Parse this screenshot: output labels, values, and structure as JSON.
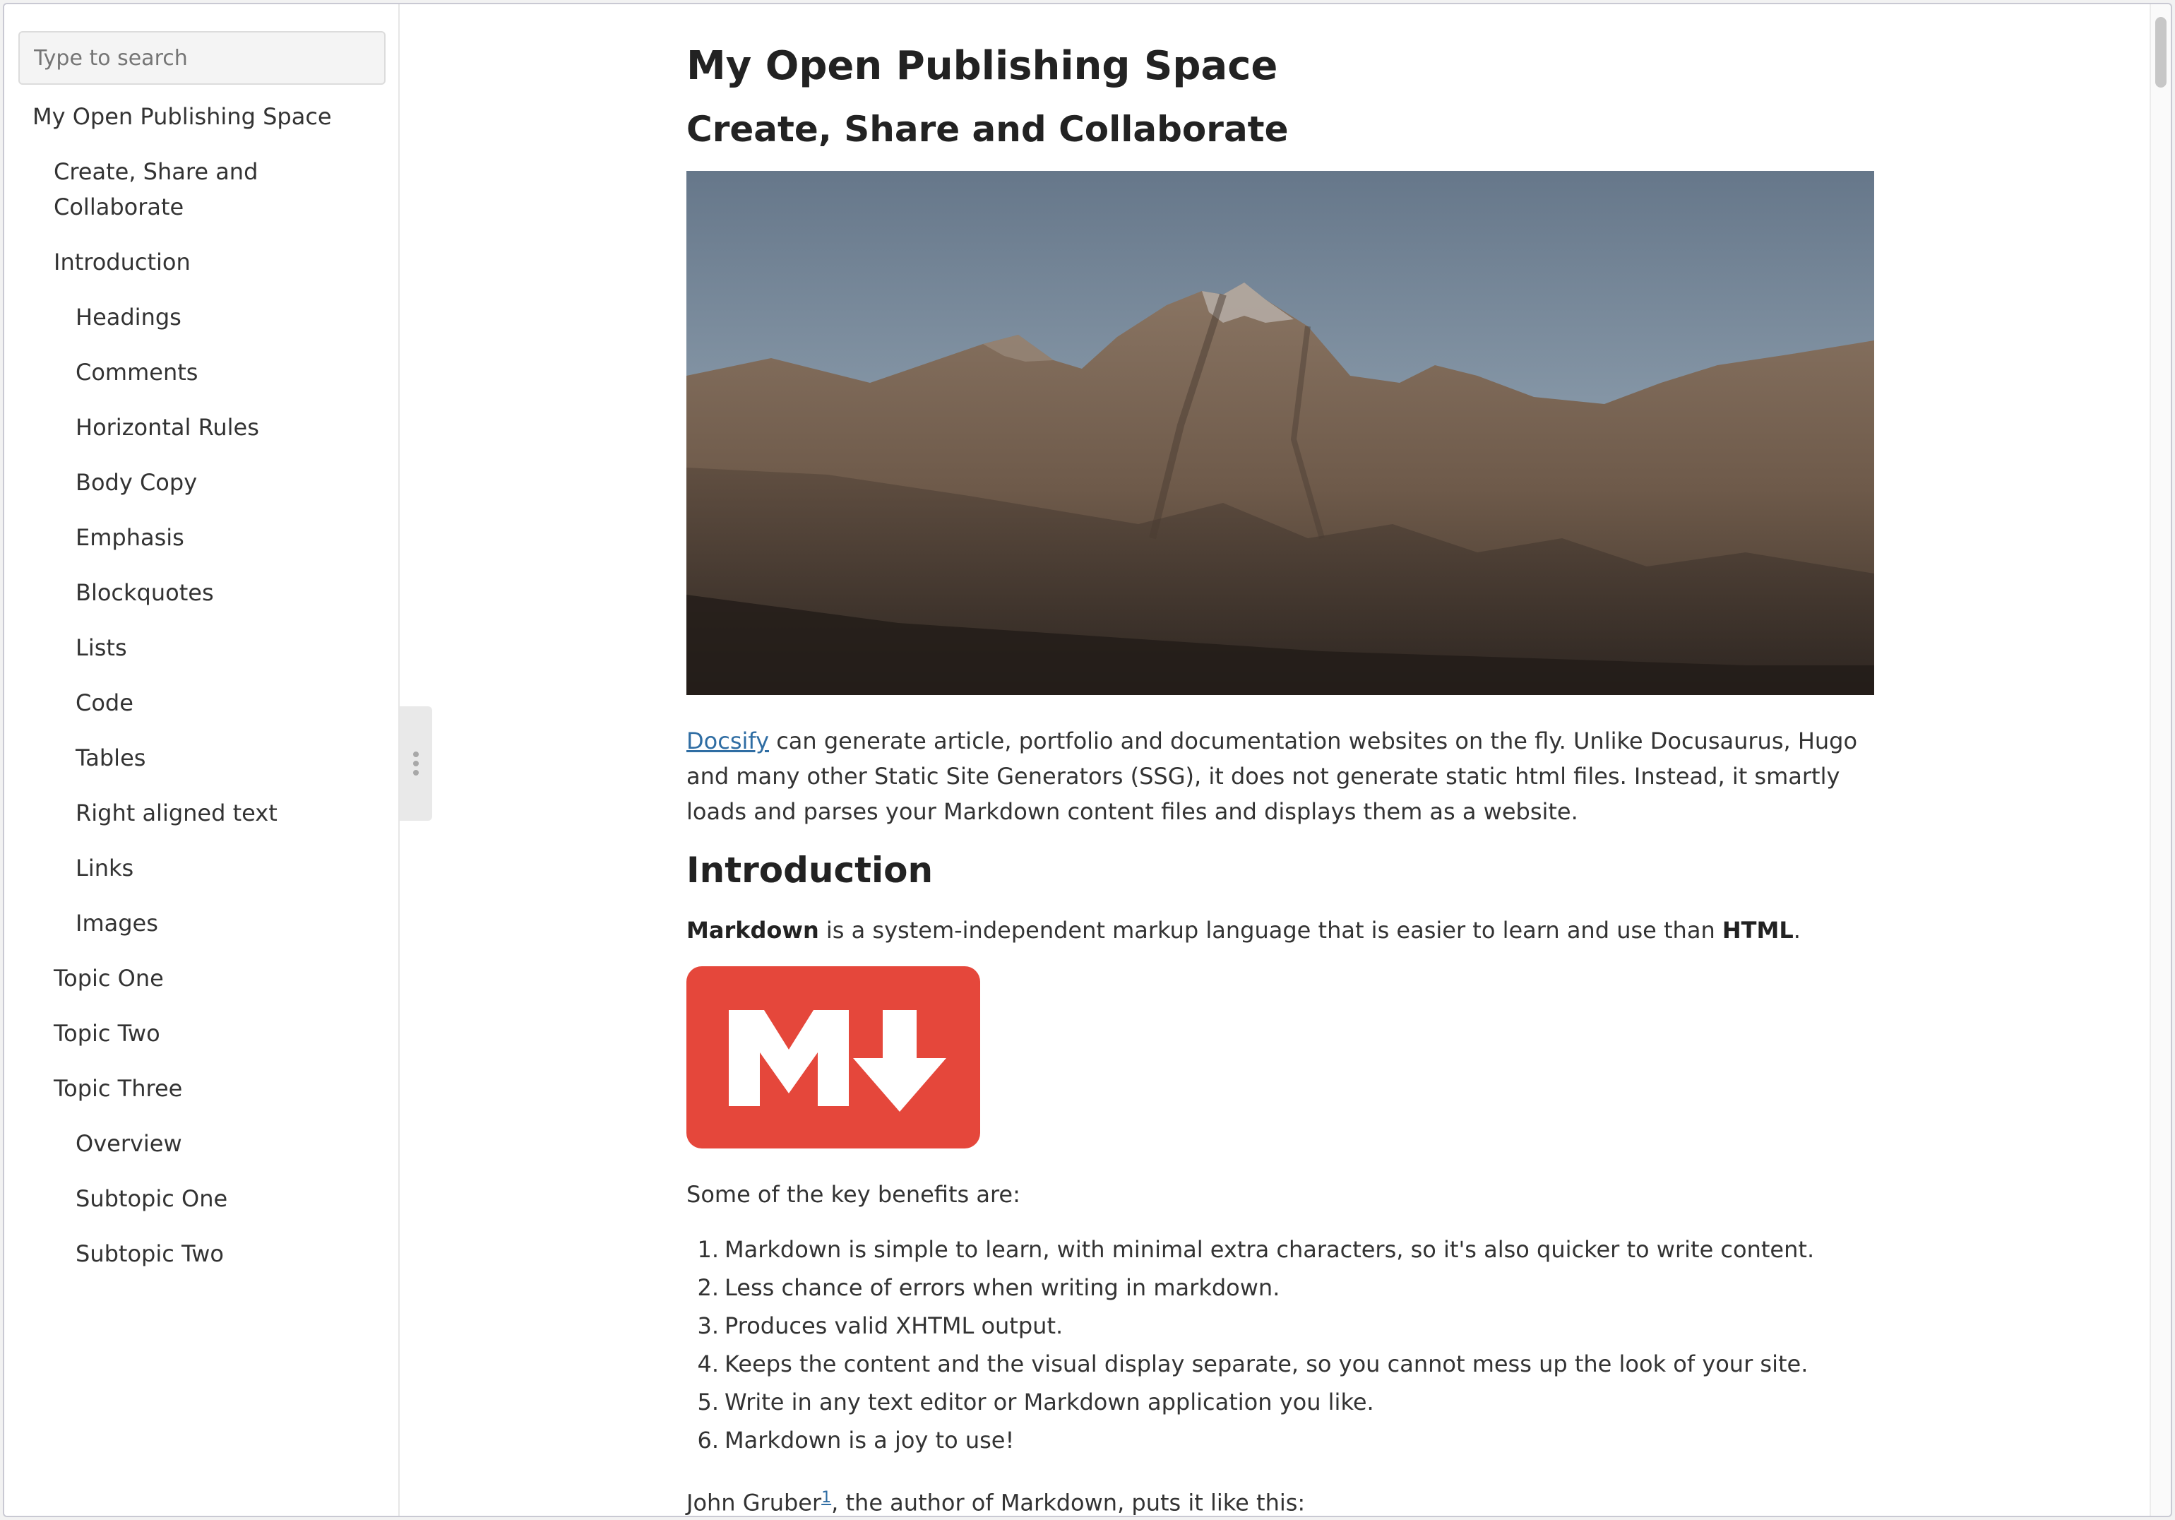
{
  "search": {
    "placeholder": "Type to search"
  },
  "sidebar": {
    "items": [
      {
        "label": "My Open Publishing Space",
        "level": 0
      },
      {
        "label": "Create, Share and Collaborate",
        "level": 1
      },
      {
        "label": "Introduction",
        "level": 1
      },
      {
        "label": "Headings",
        "level": 2
      },
      {
        "label": "Comments",
        "level": 2
      },
      {
        "label": "Horizontal Rules",
        "level": 2
      },
      {
        "label": "Body Copy",
        "level": 2
      },
      {
        "label": "Emphasis",
        "level": 2
      },
      {
        "label": "Blockquotes",
        "level": 2
      },
      {
        "label": "Lists",
        "level": 2
      },
      {
        "label": "Code",
        "level": 2
      },
      {
        "label": "Tables",
        "level": 2
      },
      {
        "label": "Right aligned text",
        "level": 2
      },
      {
        "label": "Links",
        "level": 2
      },
      {
        "label": "Images",
        "level": 2
      },
      {
        "label": "Topic One",
        "level": 1
      },
      {
        "label": "Topic Two",
        "level": 1
      },
      {
        "label": "Topic Three",
        "level": 1
      },
      {
        "label": "Overview",
        "level": 2
      },
      {
        "label": "Subtopic One",
        "level": 2
      },
      {
        "label": "Subtopic Two",
        "level": 2
      }
    ]
  },
  "main": {
    "title": "My Open Publishing Space",
    "subtitle": "Create, Share and Collaborate",
    "intro_link": "Docsify",
    "intro_text": " can generate article, portfolio and documentation websites on the fly. Unlike Docusaurus, Hugo and many other Static Site Generators (SSG), it does not generate static html files. Instead, it smartly loads and parses your Markdown content files and displays them as a website.",
    "section_heading": "Introduction",
    "md_bold": "Markdown",
    "md_text": " is a system-independent markup language that is easier to learn and use than ",
    "md_html": "HTML",
    "md_period": ".",
    "benefits_lead": "Some of the key benefits are:",
    "benefits": [
      {
        "num": "1.",
        "text": "Markdown is simple to learn, with minimal extra characters, so it's also quicker to write content."
      },
      {
        "num": "2.",
        "text": "Less chance of errors when writing in markdown."
      },
      {
        "num": "3.",
        "text": "Produces valid XHTML output."
      },
      {
        "num": "4.",
        "text": "Keeps the content and the visual display separate, so you cannot mess up the look of your site."
      },
      {
        "num": "5.",
        "text": "Write in any text editor or Markdown application you like."
      },
      {
        "num": "6.",
        "text": "Markdown is a joy to use!"
      }
    ],
    "gruber_name": "John Gruber",
    "gruber_footnote": "1",
    "gruber_rest": ", the author of Markdown, puts it like this:"
  },
  "colors": {
    "link": "#2f6da3",
    "markdown_logo": "#e5473b",
    "sky": "#7b8ea0"
  },
  "icons": {
    "markdown_logo": "markdown-logo-icon",
    "drag_handle": "vertical-ellipsis-icon"
  }
}
